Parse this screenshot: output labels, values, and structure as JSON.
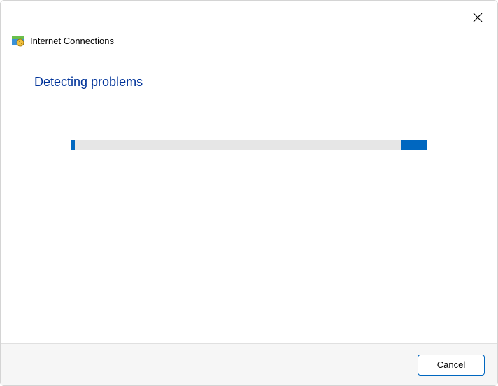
{
  "window": {
    "title": "Internet Connections",
    "close_icon": "close-icon"
  },
  "content": {
    "heading": "Detecting problems"
  },
  "progress": {
    "accent_color": "#0067c0"
  },
  "footer": {
    "cancel_label": "Cancel"
  }
}
